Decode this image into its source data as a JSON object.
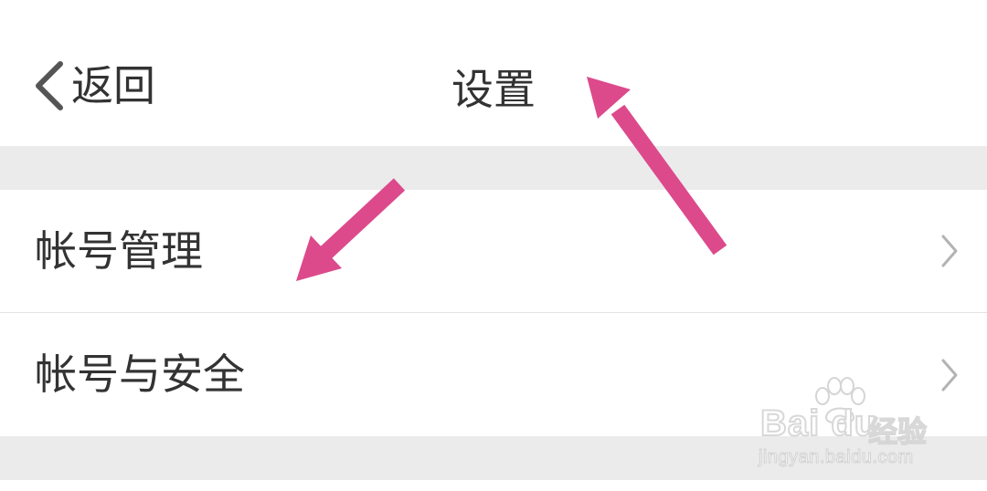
{
  "navbar": {
    "back_label": "返回",
    "title": "设置"
  },
  "settings_list": [
    {
      "label": "帐号管理"
    },
    {
      "label": "帐号与安全"
    }
  ],
  "watermark": {
    "brand": "Bai du",
    "cn": "经验",
    "url": "jingyan.baidu.com"
  },
  "colors": {
    "annotation_arrow": "#dc4a8c",
    "background_gap": "#ebebeb",
    "text": "#333333",
    "chevron": "#b3b3b3"
  },
  "icons": {
    "back": "chevron-left-icon",
    "row_disclosure": "chevron-right-icon"
  }
}
